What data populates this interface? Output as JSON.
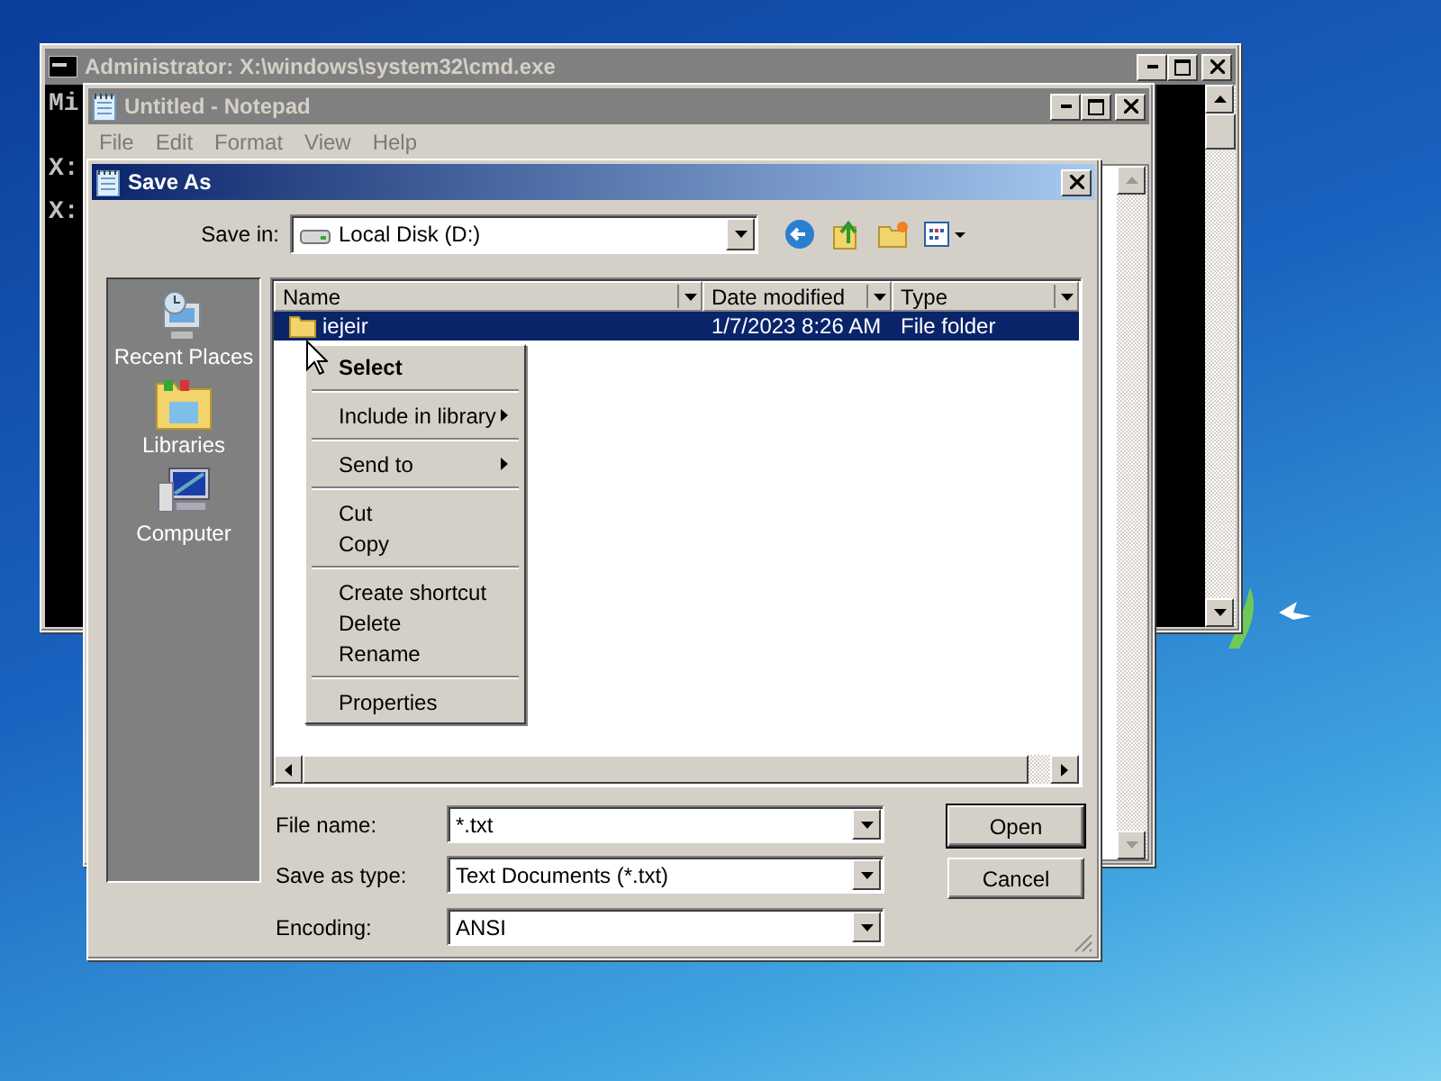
{
  "cmd_window": {
    "title": "Administrator: X:\\windows\\system32\\cmd.exe",
    "lines": [
      "Mi",
      "X:",
      "X:"
    ]
  },
  "notepad_window": {
    "title": "Untitled - Notepad",
    "menu": [
      "File",
      "Edit",
      "Format",
      "View",
      "Help"
    ]
  },
  "save_dialog": {
    "title": "Save As",
    "save_in_label": "Save in:",
    "save_in_value": "Local Disk (D:)",
    "places": [
      {
        "label": "Recent Places",
        "kind": "recent"
      },
      {
        "label": "Libraries",
        "kind": "libraries"
      },
      {
        "label": "Computer",
        "kind": "computer"
      }
    ],
    "columns": [
      "Name",
      "Date modified",
      "Type"
    ],
    "rows": [
      {
        "name": "iejeir",
        "date": "1/7/2023 8:26 AM",
        "type": "File folder",
        "selected": true
      }
    ],
    "fields": [
      {
        "label": "File name:",
        "value": "*.txt"
      },
      {
        "label": "Save as type:",
        "value": "Text Documents (*.txt)"
      },
      {
        "label": "Encoding:",
        "value": "ANSI"
      }
    ],
    "buttons": [
      "Open",
      "Cancel"
    ]
  },
  "context_menu": {
    "groups": [
      [
        {
          "label": "Select",
          "default": true,
          "submenu": false
        }
      ],
      [
        {
          "label": "Include in library",
          "default": false,
          "submenu": true
        }
      ],
      [
        {
          "label": "Send to",
          "default": false,
          "submenu": true
        }
      ],
      [
        {
          "label": "Cut",
          "default": false,
          "submenu": false
        },
        {
          "label": "Copy",
          "default": false,
          "submenu": false
        }
      ],
      [
        {
          "label": "Create shortcut",
          "default": false,
          "submenu": false
        },
        {
          "label": "Delete",
          "default": false,
          "submenu": false
        },
        {
          "label": "Rename",
          "default": false,
          "submenu": false
        }
      ],
      [
        {
          "label": "Properties",
          "default": false,
          "submenu": false
        }
      ]
    ]
  }
}
